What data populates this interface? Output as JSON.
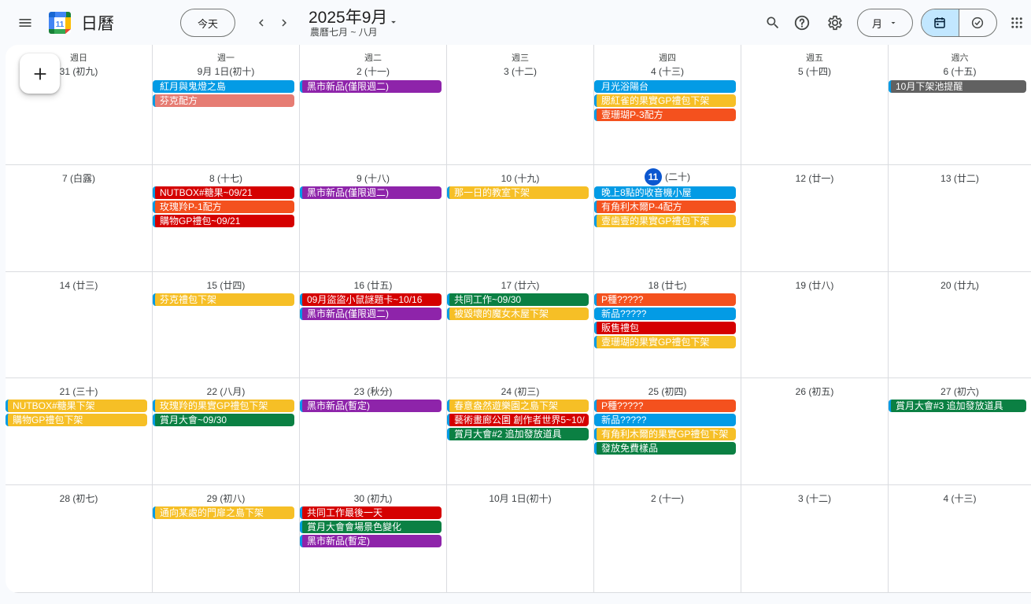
{
  "app": {
    "title": "日曆",
    "logo_day": "11"
  },
  "header": {
    "today_label": "今天",
    "month_title": "2025年9月",
    "lunar_subtitle": "農曆七月 ~ 八月",
    "view_label": "月"
  },
  "icons": {
    "menu": "hamburger-icon",
    "prev": "chevron-left-icon",
    "next": "chevron-right-icon",
    "dropdown": "caret-down-icon",
    "search": "search-icon",
    "help": "help-icon",
    "settings": "gear-icon",
    "calendar_view": "calendar-icon",
    "tasks_view": "check-circle-icon",
    "apps": "apps-grid-icon",
    "create": "plus-icon"
  },
  "colors": {
    "blue": "#039be5",
    "salmon": "#e67c73",
    "purple": "#8e24aa",
    "yellow": "#f6bf26",
    "tangerine": "#f4511e",
    "tomato": "#d50000",
    "green": "#0b8043",
    "graphite": "#616161",
    "today": "#0b57d0",
    "accent_selected": "#c2e7ff"
  },
  "weekdays": [
    "週日",
    "週一",
    "週二",
    "週三",
    "週四",
    "週五",
    "週六"
  ],
  "weeks": [
    {
      "days": [
        {
          "label": "31 (初九)",
          "events": []
        },
        {
          "label": "9月 1日(初十)",
          "events": [
            {
              "title": "紅月與鬼燈之島",
              "color": "#039be5"
            },
            {
              "title": "芬克配方",
              "color": "#e67c73"
            }
          ]
        },
        {
          "label": "2 (十一)",
          "events": [
            {
              "title": "黑市新品(僅限週二)",
              "color": "#8e24aa"
            }
          ]
        },
        {
          "label": "3 (十二)",
          "events": []
        },
        {
          "label": "4 (十三)",
          "events": [
            {
              "title": "月光浴陽台",
              "color": "#039be5"
            },
            {
              "title": "腮紅雀的果實GP禮包下架",
              "color": "#f6bf26"
            },
            {
              "title": "壹珊瑚P-3配方",
              "color": "#f4511e"
            }
          ]
        },
        {
          "label": "5 (十四)",
          "events": []
        },
        {
          "label": "6 (十五)",
          "events": [
            {
              "title": "10月下架池提醒",
              "color": "#616161"
            }
          ]
        }
      ]
    },
    {
      "days": [
        {
          "label": "7 (白露)",
          "events": []
        },
        {
          "label": "8 (十七)",
          "events": [
            {
              "title": "NUTBOX#糖果~09/21",
              "color": "#d50000"
            },
            {
              "title": "玫瑰羚P-1配方",
              "color": "#f4511e"
            },
            {
              "title": "購物GP禮包~09/21",
              "color": "#d50000"
            }
          ]
        },
        {
          "label": "9 (十八)",
          "events": [
            {
              "title": "黑市新品(僅限週二)",
              "color": "#8e24aa"
            }
          ]
        },
        {
          "label": "10 (十九)",
          "events": [
            {
              "title": "那一日的教室下架",
              "color": "#f6bf26"
            }
          ]
        },
        {
          "label": "(二十)",
          "num": "11",
          "today": true,
          "events": [
            {
              "title": "晚上8點的收音機小屋",
              "color": "#039be5"
            },
            {
              "title": "有角利木爾P-4配方",
              "color": "#f4511e"
            },
            {
              "title": "壹歯壹的果實GP禮包下架",
              "color": "#f6bf26"
            }
          ]
        },
        {
          "label": "12 (廿一)",
          "events": []
        },
        {
          "label": "13 (廿二)",
          "events": []
        }
      ]
    },
    {
      "days": [
        {
          "label": "14 (廿三)",
          "events": []
        },
        {
          "label": "15 (廿四)",
          "events": [
            {
              "title": "芬克禮包下架",
              "color": "#f6bf26"
            }
          ]
        },
        {
          "label": "16 (廿五)",
          "events": [
            {
              "title": "09月盜盜小鼠謎題卡~10/16",
              "color": "#d50000"
            },
            {
              "title": "黑市新品(僅限週二)",
              "color": "#8e24aa"
            }
          ]
        },
        {
          "label": "17 (廿六)",
          "events": [
            {
              "title": "共同工作~09/30",
              "color": "#0b8043"
            },
            {
              "title": "被毀壞的魔女木屋下架",
              "color": "#f6bf26"
            }
          ]
        },
        {
          "label": "18 (廿七)",
          "events": [
            {
              "title": "P種?????",
              "color": "#f4511e"
            },
            {
              "title": "新品?????",
              "color": "#039be5"
            },
            {
              "title": "販售禮包",
              "color": "#d50000"
            },
            {
              "title": "壹珊瑚的果實GP禮包下架",
              "color": "#f6bf26"
            }
          ]
        },
        {
          "label": "19 (廿八)",
          "events": []
        },
        {
          "label": "20 (廿九)",
          "events": []
        }
      ]
    },
    {
      "days": [
        {
          "label": "21 (三十)",
          "events": [
            {
              "title": "NUTBOX#糖果下架",
              "color": "#f6bf26"
            },
            {
              "title": "購物GP禮包下架",
              "color": "#f6bf26"
            }
          ]
        },
        {
          "label": "22 (八月)",
          "events": [
            {
              "title": "玫瑰羚的果實GP禮包下架",
              "color": "#f6bf26"
            },
            {
              "title": "賞月大會~09/30",
              "color": "#0b8043"
            }
          ]
        },
        {
          "label": "23 (秋分)",
          "events": [
            {
              "title": "黑市新品(暫定)",
              "color": "#8e24aa"
            }
          ]
        },
        {
          "label": "24 (初三)",
          "events": [
            {
              "title": "春意盎然遊樂園之島下架",
              "color": "#f6bf26"
            },
            {
              "title": "藝術畫廊公園 創作者世界5~10/",
              "color": "#d50000"
            },
            {
              "title": "賞月大會#2 追加發放道具",
              "color": "#0b8043"
            }
          ]
        },
        {
          "label": "25 (初四)",
          "events": [
            {
              "title": "P種?????",
              "color": "#f4511e"
            },
            {
              "title": "新品?????",
              "color": "#039be5"
            },
            {
              "title": "有角利木爾的果實GP禮包下架",
              "color": "#f6bf26"
            },
            {
              "title": "發放免費樣品",
              "color": "#0b8043"
            }
          ]
        },
        {
          "label": "26 (初五)",
          "events": []
        },
        {
          "label": "27 (初六)",
          "events": [
            {
              "title": "賞月大會#3 追加發放道具",
              "color": "#0b8043"
            }
          ]
        }
      ]
    },
    {
      "days": [
        {
          "label": "28 (初七)",
          "events": []
        },
        {
          "label": "29 (初八)",
          "events": [
            {
              "title": "通向某處的門扉之島下架",
              "color": "#f6bf26"
            }
          ]
        },
        {
          "label": "30 (初九)",
          "events": [
            {
              "title": "共同工作最後一天",
              "color": "#d50000"
            },
            {
              "title": "賞月大會會場景色變化",
              "color": "#0b8043"
            },
            {
              "title": "黑市新品(暫定)",
              "color": "#8e24aa"
            }
          ]
        },
        {
          "label": "10月 1日(初十)",
          "events": []
        },
        {
          "label": "2 (十一)",
          "events": []
        },
        {
          "label": "3 (十二)",
          "events": []
        },
        {
          "label": "4 (十三)",
          "events": []
        }
      ]
    }
  ]
}
